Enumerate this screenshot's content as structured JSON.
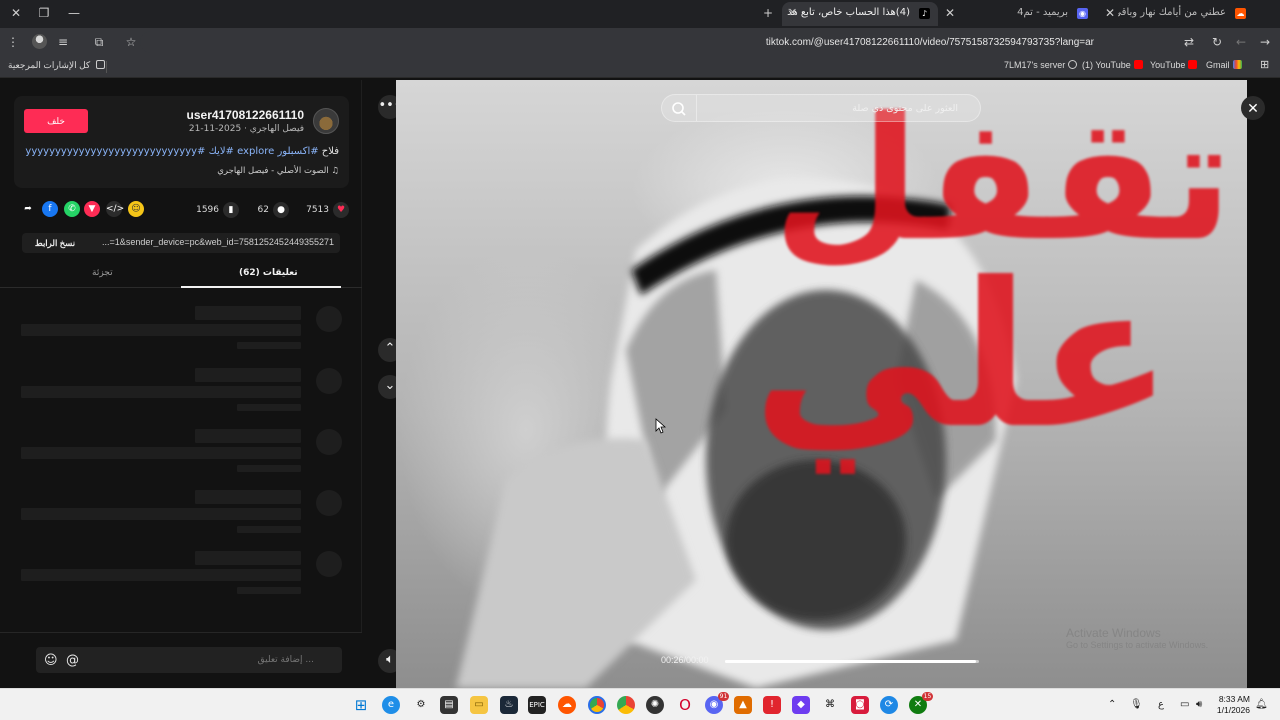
{
  "browser": {
    "tabs": [
      {
        "title": "(4)هذا الحساب خاص، تابع هذ",
        "active": true,
        "favicon_color": "#ffffff"
      },
      {
        "title": "بريميد - تم4",
        "active": false,
        "favicon_color": "#5865f2"
      },
      {
        "title": "عطني من أيامك نهار وباقي Cloud",
        "active": false,
        "favicon_color": "#ff5500"
      }
    ],
    "url": "tiktok.com/@user41708122661110/video/7575158732594793735?lang=ar",
    "bookmarks": {
      "all_bookmarks": "كل الإشارات المرجعية",
      "items": [
        {
          "label": "7LM17's server",
          "icon": "globe-icon"
        },
        {
          "label": "(1) YouTube",
          "icon": "youtube-icon"
        },
        {
          "label": "YouTube",
          "icon": "youtube-icon"
        },
        {
          "label": "Gmail",
          "icon": "gmail-icon"
        }
      ]
    }
  },
  "post": {
    "author_username": "user41708122661110",
    "author_meta": "فيصل الهاجري · 2025-11-21",
    "follow_label": "خلف",
    "caption_prefix": "فلاح ",
    "caption_tags": "#اكسبلور explore #لايك #yyyyyyyyyyyyyyyyyyyyyyyyyyyyy",
    "music": "الصوت الأصلي - فيصل الهاجري",
    "likes": "7513",
    "comments": "62",
    "saves": "1596",
    "link_text": "...=1&sender_device=pc&web_id=7581252452449355271",
    "copy_link_label": "نسخ الرابط",
    "tabs": {
      "comments": "تعليقات (62)",
      "creator_videos": "تجزئة"
    },
    "comment_placeholder": "... إضافة تعليق"
  },
  "video": {
    "overlay_line1": "تقفل",
    "overlay_line2": "علي",
    "search_placeholder": "العثور على محتوى ذي صلة",
    "time": "00:26/00:00",
    "progress": 0.99,
    "watermark_title": "Activate Windows",
    "watermark_sub": "Go to Settings to activate Windows."
  },
  "taskbar": {
    "time": "8:33 AM",
    "date": "1/1/2026",
    "language": "ع"
  }
}
